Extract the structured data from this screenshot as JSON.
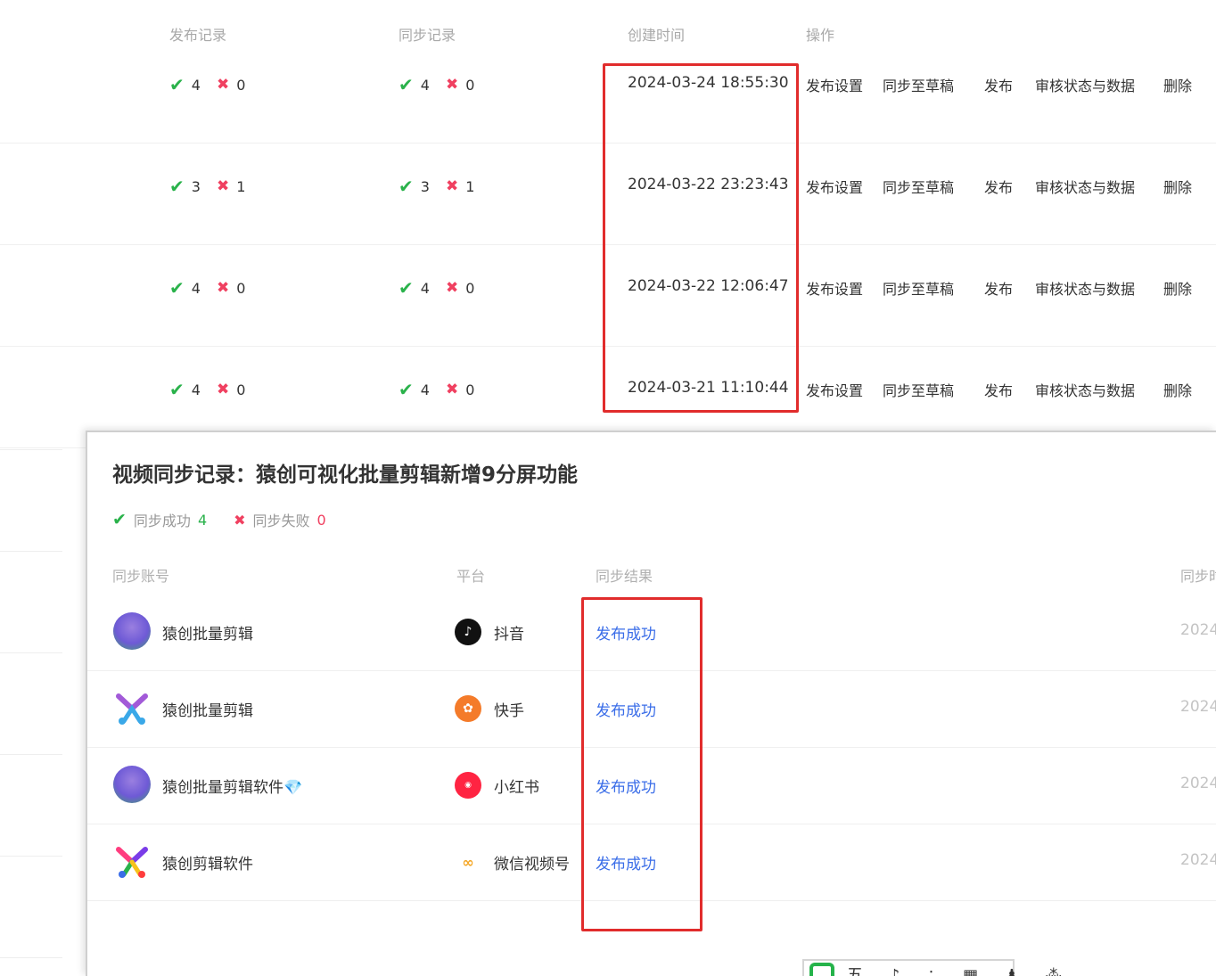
{
  "table": {
    "headers": {
      "publish": "发布记录",
      "sync": "同步记录",
      "created": "创建时间",
      "ops": "操作"
    },
    "rows": [
      {
        "pub_ok": "4",
        "pub_fail": "0",
        "sync_ok": "4",
        "sync_fail": "0",
        "time": "2024-03-24 18:55:30"
      },
      {
        "pub_ok": "3",
        "pub_fail": "1",
        "sync_ok": "3",
        "sync_fail": "1",
        "time": "2024-03-22 23:23:43"
      },
      {
        "pub_ok": "4",
        "pub_fail": "0",
        "sync_ok": "4",
        "sync_fail": "0",
        "time": "2024-03-22 12:06:47"
      },
      {
        "pub_ok": "4",
        "pub_fail": "0",
        "sync_ok": "4",
        "sync_fail": "0",
        "time": "2024-03-21 11:10:44"
      }
    ],
    "actions": {
      "settings": "发布设置",
      "sync_draft": "同步至草稿",
      "publish": "发布",
      "review": "审核状态与数据",
      "delete": "删除"
    }
  },
  "modal": {
    "title": "视频同步记录：猿创可视化批量剪辑新增9分屏功能",
    "success_label": "同步成功",
    "success_count": "4",
    "fail_label": "同步失败",
    "fail_count": "0",
    "headers": {
      "account": "同步账号",
      "platform": "平台",
      "result": "同步结果",
      "time": "同步时"
    },
    "rows": [
      {
        "account": "猿创批量剪辑",
        "platform": "抖音",
        "result": "发布成功",
        "time": "2024"
      },
      {
        "account": "猿创批量剪辑",
        "platform": "快手",
        "result": "发布成功",
        "time": "2024"
      },
      {
        "account": "猿创批量剪辑软件💎",
        "platform": "小红书",
        "result": "发布成功",
        "time": "2024"
      },
      {
        "account": "猿创剪辑软件",
        "platform": "微信视频号",
        "result": "发布成功",
        "time": "2024"
      }
    ]
  },
  "icons": {
    "success": "check-icon",
    "fail": "cross-icon",
    "douyin": "douyin-icon",
    "kuaishou": "kuaishou-icon",
    "xiaohongshu": "xiaohongshu-icon",
    "channels": "wechat-channels-icon"
  },
  "colors": {
    "success": "#2ab24b",
    "fail": "#f04060",
    "link": "#3a6de8",
    "annotation": "#e12c2c"
  },
  "partial_text": "五 ♪ ∴ ▦ ♟ ⁂"
}
